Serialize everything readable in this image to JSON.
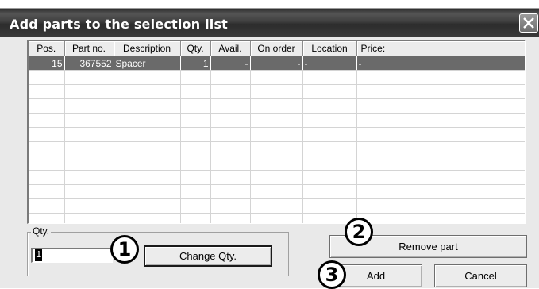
{
  "window": {
    "title": "Add parts to the selection list"
  },
  "table": {
    "columns": [
      "Pos.",
      "Part no.",
      "Description",
      "Qty.",
      "Avail.",
      "On order",
      "Location",
      "Price:"
    ],
    "rows": [
      {
        "pos": "15",
        "part_no": "367552",
        "description": "Spacer",
        "qty": "1",
        "avail": "-",
        "on_order": "-",
        "location": "-",
        "price": "-"
      }
    ]
  },
  "qty_group": {
    "legend": "Qty.",
    "value": "1"
  },
  "buttons": {
    "change_qty": "Change Qty.",
    "remove_part": "Remove part",
    "add": "Add",
    "cancel": "Cancel"
  },
  "callouts": [
    "1",
    "2",
    "3"
  ]
}
